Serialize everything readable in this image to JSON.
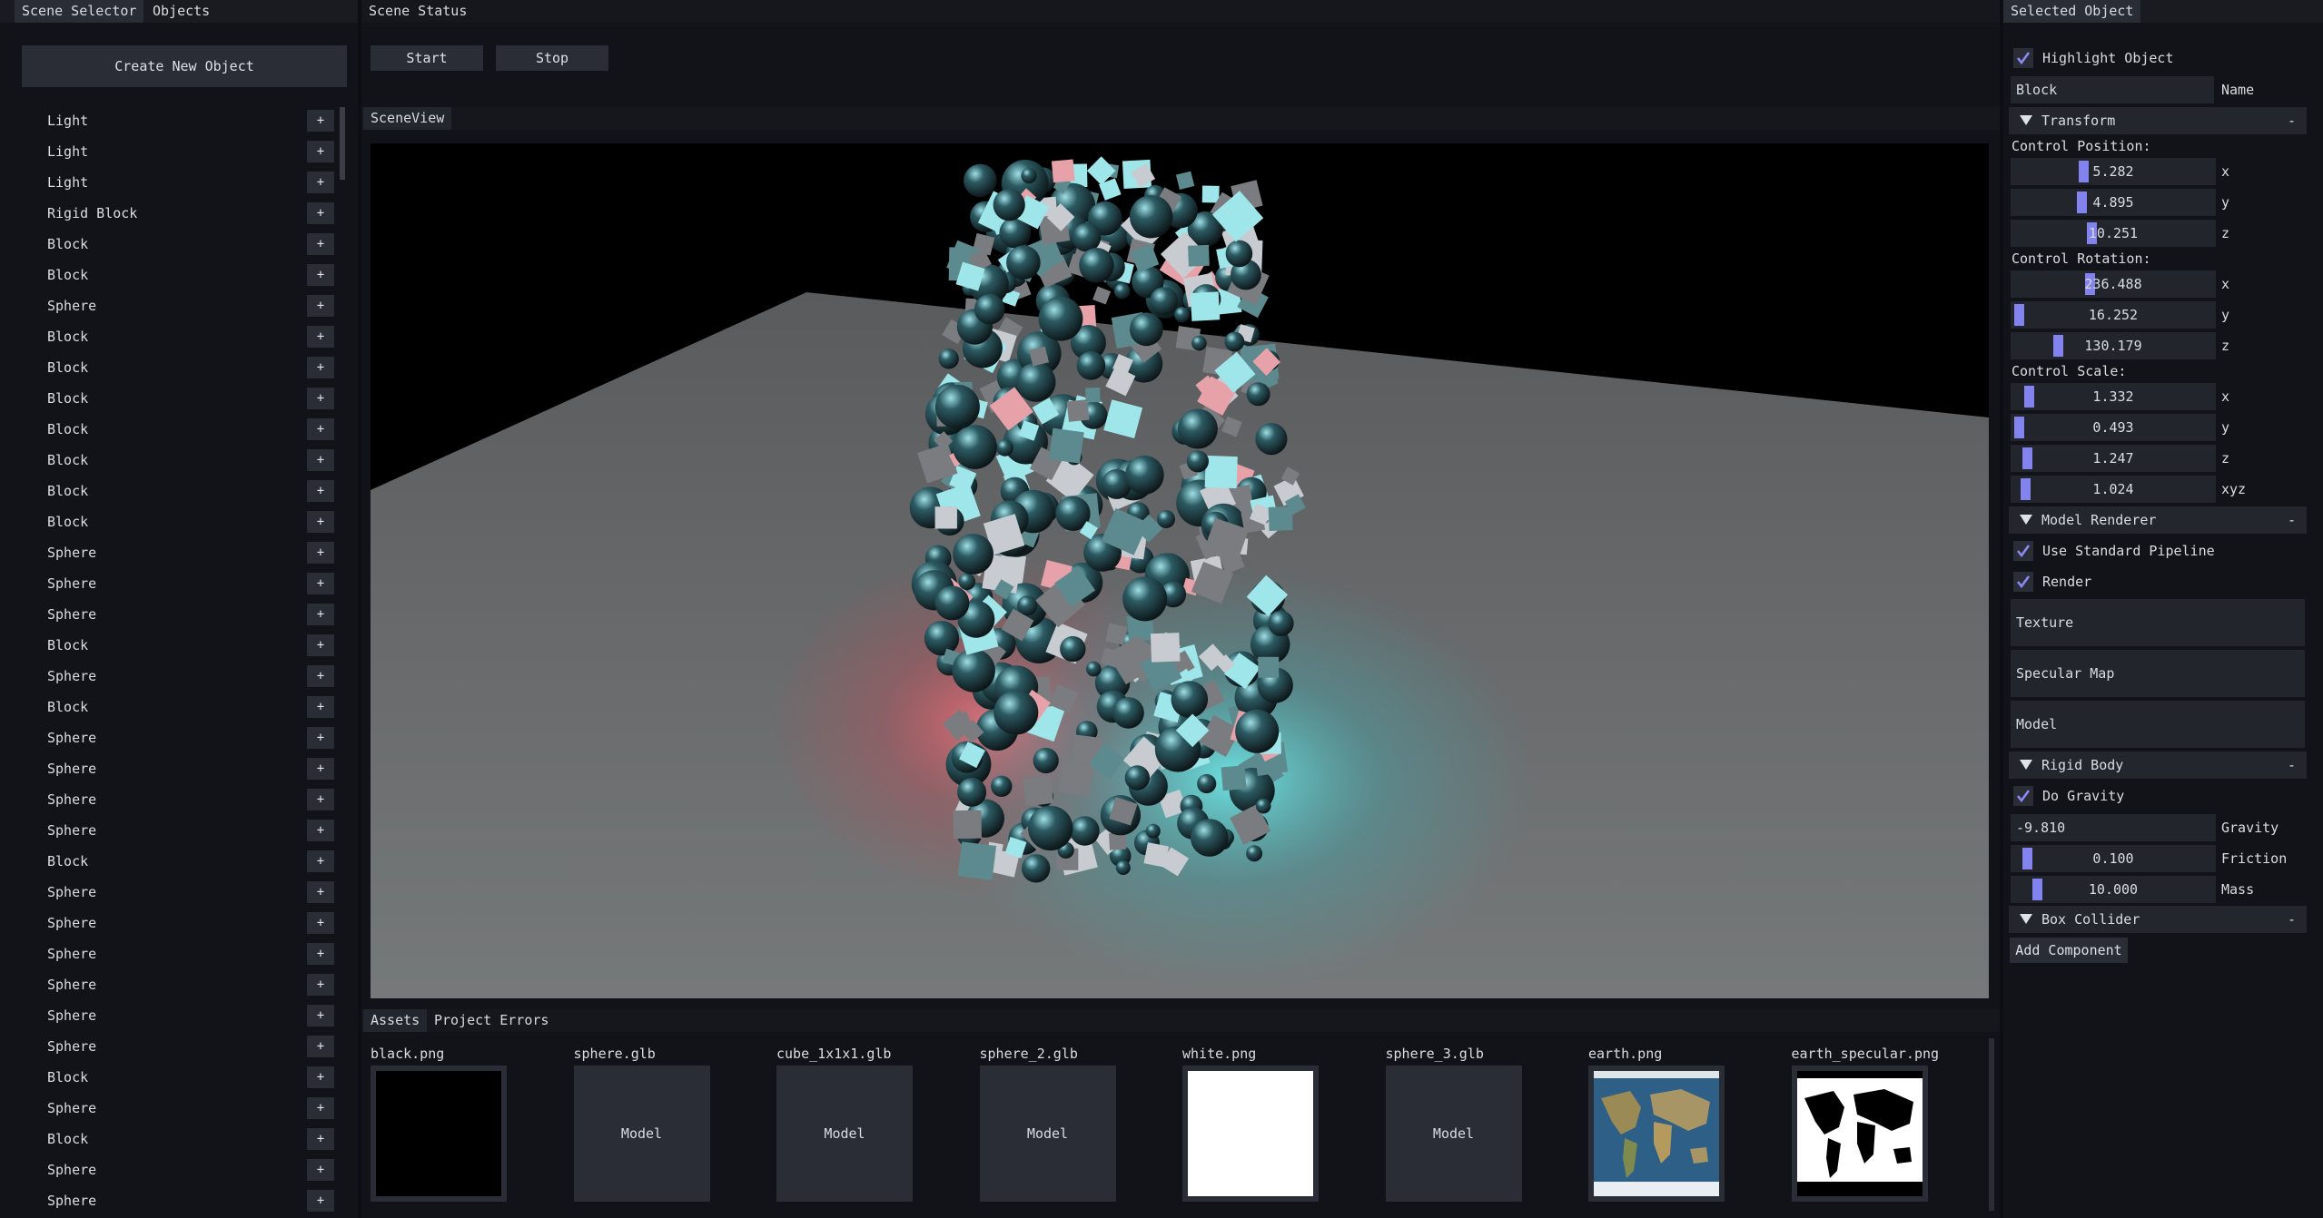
{
  "left_panel": {
    "tabs": [
      "Scene Selector",
      "Objects"
    ],
    "create_button": "Create New Object",
    "plus_label": "+",
    "objects": [
      "Light",
      "Light",
      "Light",
      "Rigid Block",
      "Block",
      "Block",
      "Sphere",
      "Block",
      "Block",
      "Block",
      "Block",
      "Block",
      "Block",
      "Block",
      "Sphere",
      "Sphere",
      "Sphere",
      "Block",
      "Sphere",
      "Block",
      "Sphere",
      "Sphere",
      "Sphere",
      "Sphere",
      "Block",
      "Sphere",
      "Sphere",
      "Sphere",
      "Sphere",
      "Sphere",
      "Sphere",
      "Block",
      "Sphere",
      "Block",
      "Sphere",
      "Sphere"
    ]
  },
  "scene_status": {
    "title": "Scene Status",
    "start_label": "Start",
    "stop_label": "Stop"
  },
  "scene_view": {
    "tab": "SceneView"
  },
  "assets_panel": {
    "tabs": [
      "Assets",
      "Project Errors"
    ],
    "items": [
      {
        "name": "black.png",
        "kind": "image",
        "preview": "black"
      },
      {
        "name": "sphere.glb",
        "kind": "model",
        "label": "Model"
      },
      {
        "name": "cube_1x1x1.glb",
        "kind": "model",
        "label": "Model"
      },
      {
        "name": "sphere_2.glb",
        "kind": "model",
        "label": "Model"
      },
      {
        "name": "white.png",
        "kind": "image",
        "preview": "white"
      },
      {
        "name": "sphere_3.glb",
        "kind": "model",
        "label": "Model"
      },
      {
        "name": "earth.png",
        "kind": "image",
        "preview": "earth"
      },
      {
        "name": "earth_specular.png",
        "kind": "image",
        "preview": "earth-specular"
      }
    ]
  },
  "selected_object": {
    "tab": "Selected Object",
    "highlight_label": "Highlight Object",
    "highlight_checked": true,
    "name_value": "Block",
    "name_label": "Name",
    "transform": {
      "title": "Transform",
      "collapse": "-",
      "position_label": "Control Position:",
      "position": [
        {
          "value": "5.282",
          "axis": "x",
          "fill": 0.35
        },
        {
          "value": "4.895",
          "axis": "y",
          "fill": 0.34
        },
        {
          "value": "10.251",
          "axis": "z",
          "fill": 0.39
        }
      ],
      "rotation_label": "Control Rotation:",
      "rotation": [
        {
          "value": "236.488",
          "axis": "x",
          "fill": 0.38
        },
        {
          "value": "16.252",
          "axis": "y",
          "fill": 0.02
        },
        {
          "value": "130.179",
          "axis": "z",
          "fill": 0.22
        }
      ],
      "scale_label": "Control Scale:",
      "scale": [
        {
          "value": "1.332",
          "axis": "x",
          "fill": 0.07
        },
        {
          "value": "0.493",
          "axis": "y",
          "fill": 0.02
        },
        {
          "value": "1.247",
          "axis": "z",
          "fill": 0.06
        },
        {
          "value": "1.024",
          "axis": "xyz",
          "fill": 0.05
        }
      ]
    },
    "model_renderer": {
      "title": "Model Renderer",
      "collapse": "-",
      "standard_pipeline_label": "Use Standard Pipeline",
      "render_label": "Render",
      "texture_label": "Texture",
      "specular_label": "Specular Map",
      "model_label": "Model"
    },
    "rigid_body": {
      "title": "Rigid Body",
      "collapse": "-",
      "gravity_toggle_label": "Do Gravity",
      "gravity_value": "-9.810",
      "gravity_label": "Gravity",
      "friction_value": "0.100",
      "friction_label": "Friction",
      "friction_fill": 0.06,
      "mass_value": "10.000",
      "mass_label": "Mass",
      "mass_fill": 0.11
    },
    "box_collider": {
      "title": "Box Collider",
      "collapse": "-"
    },
    "add_component_label": "Add Component"
  },
  "colors": {
    "accent": "#8383f0",
    "check": "#8a8af5",
    "panel_bg": "#111318",
    "widget_bg": "#2a2d35"
  }
}
